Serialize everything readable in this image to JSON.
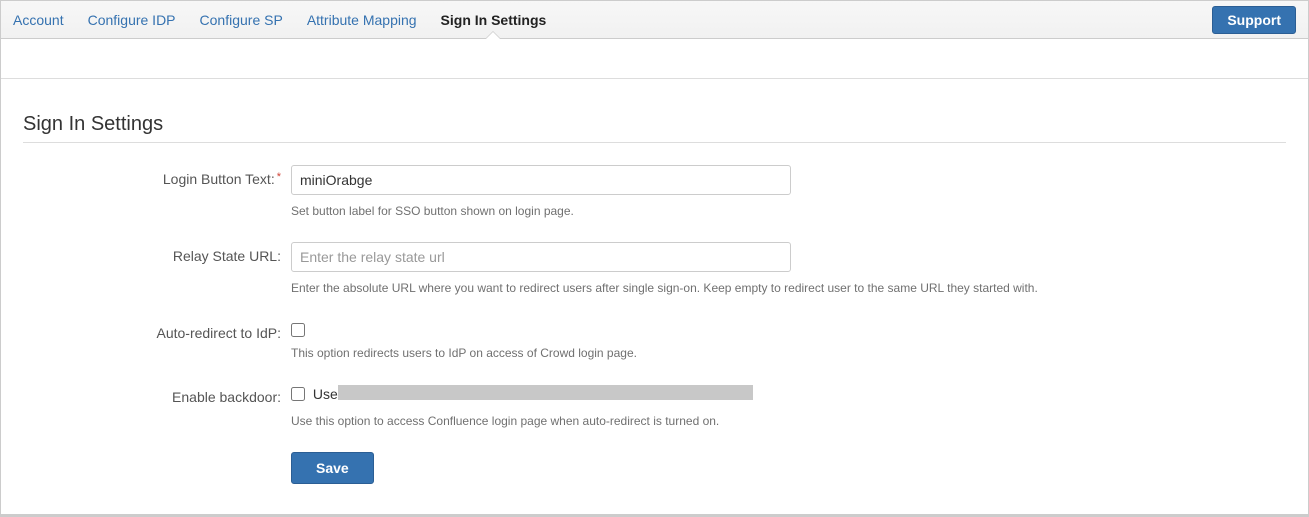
{
  "tabs": {
    "items": [
      {
        "label": "Account",
        "active": false
      },
      {
        "label": "Configure IDP",
        "active": false
      },
      {
        "label": "Configure SP",
        "active": false
      },
      {
        "label": "Attribute Mapping",
        "active": false
      },
      {
        "label": "Sign In Settings",
        "active": true
      }
    ],
    "support": "Support"
  },
  "section": {
    "title": "Sign In Settings"
  },
  "form": {
    "login_button": {
      "label": "Login Button Text:",
      "value": "miniOrabge",
      "help": "Set button label for SSO button shown on login page."
    },
    "relay_state": {
      "label": "Relay State URL:",
      "placeholder": "Enter the relay state url",
      "value": "",
      "help": "Enter the absolute URL where you want to redirect users after single sign-on. Keep empty to redirect user to the same URL they started with."
    },
    "auto_redirect": {
      "label": "Auto-redirect to IdP:",
      "help": "This option redirects users to IdP on access of Crowd login page."
    },
    "backdoor": {
      "label": "Enable backdoor:",
      "inline": "Use",
      "help": "Use this option to access Confluence login page when auto-redirect is turned on."
    },
    "save": "Save"
  }
}
